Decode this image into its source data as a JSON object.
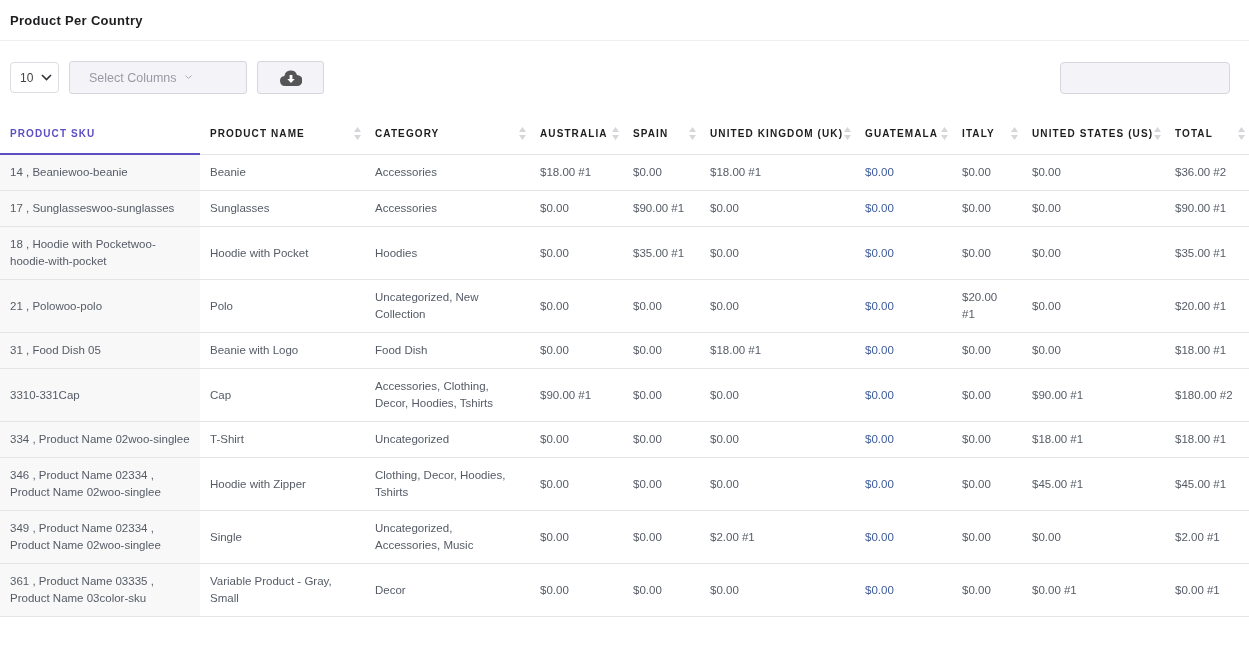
{
  "title": "Product Per Country",
  "toolbar": {
    "page_size": "10",
    "columns_placeholder": "Select Columns"
  },
  "table": {
    "columns": [
      {
        "label": "PRODUCT SKU",
        "selected": true
      },
      {
        "label": "PRODUCT NAME",
        "selected": false
      },
      {
        "label": "CATEGORY",
        "selected": false
      },
      {
        "label": "AUSTRALIA",
        "selected": false
      },
      {
        "label": "SPAIN",
        "selected": false
      },
      {
        "label": "UNITED KINGDOM (UK)",
        "selected": false
      },
      {
        "label": "GUATEMALA",
        "selected": false
      },
      {
        "label": "ITALY",
        "selected": false
      },
      {
        "label": "UNITED STATES (US)",
        "selected": false
      },
      {
        "label": "TOTAL",
        "selected": false
      }
    ],
    "rows": [
      [
        "14 , Beaniewoo-beanie",
        "Beanie",
        "Accessories",
        "$18.00 #1",
        "$0.00",
        "$18.00 #1",
        "$0.00",
        "$0.00",
        "$0.00",
        "$36.00 #2"
      ],
      [
        "17 , Sunglasseswoo-sunglasses",
        "Sunglasses",
        "Accessories",
        "$0.00",
        "$90.00 #1",
        "$0.00",
        "$0.00",
        "$0.00",
        "$0.00",
        "$90.00 #1"
      ],
      [
        "18 , Hoodie with Pocketwoo-hoodie-with-pocket",
        "Hoodie with Pocket",
        "Hoodies",
        "$0.00",
        "$35.00 #1",
        "$0.00",
        "$0.00",
        "$0.00",
        "$0.00",
        "$35.00 #1"
      ],
      [
        "21 , Polowoo-polo",
        "Polo",
        "Uncategorized, New Collection",
        "$0.00",
        "$0.00",
        "$0.00",
        "$0.00",
        "$20.00 #1",
        "$0.00",
        "$20.00 #1"
      ],
      [
        "31 , Food Dish 05",
        "Beanie with Logo",
        "Food Dish",
        "$0.00",
        "$0.00",
        "$18.00 #1",
        "$0.00",
        "$0.00",
        "$0.00",
        "$18.00 #1"
      ],
      [
        "3310-331Cap",
        "Cap",
        "Accessories, Clothing, Decor, Hoodies, Tshirts",
        "$90.00 #1",
        "$0.00",
        "$0.00",
        "$0.00",
        "$0.00",
        "$90.00 #1",
        "$180.00 #2"
      ],
      [
        "334 , Product Name 02woo-singlee",
        "T-Shirt",
        "Uncategorized",
        "$0.00",
        "$0.00",
        "$0.00",
        "$0.00",
        "$0.00",
        "$18.00 #1",
        "$18.00 #1"
      ],
      [
        "346 , Product Name 02334 , Product Name 02woo-singlee",
        "Hoodie with Zipper",
        "Clothing, Decor, Hoodies, Tshirts",
        "$0.00",
        "$0.00",
        "$0.00",
        "$0.00",
        "$0.00",
        "$45.00 #1",
        "$45.00 #1"
      ],
      [
        "349 , Product Name 02334 , Product Name 02woo-singlee",
        "Single",
        "Uncategorized, Accessories, Music",
        "$0.00",
        "$0.00",
        "$2.00 #1",
        "$0.00",
        "$0.00",
        "$0.00",
        "$2.00 #1"
      ],
      [
        "361 , Product Name 03335 , Product Name 03color-sku",
        "Variable Product - Gray, Small",
        "Decor",
        "$0.00",
        "$0.00",
        "$0.00",
        "$0.00",
        "$0.00",
        "$0.00 #1",
        "$0.00 #1"
      ]
    ]
  }
}
